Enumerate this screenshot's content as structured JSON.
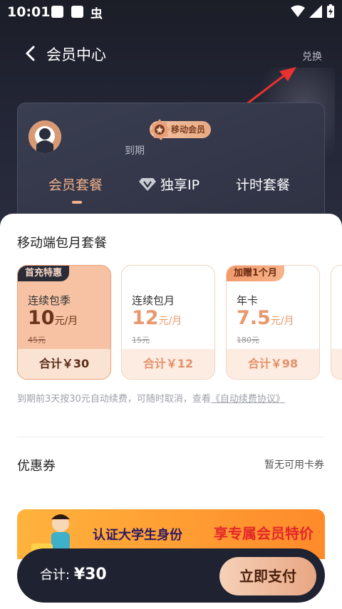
{
  "status_bar": {
    "time": "10:01",
    "bug_glyph": "虫"
  },
  "header": {
    "title": "会员中心",
    "redeem": "兑换"
  },
  "member_card": {
    "badge": "移动会员",
    "expire_label": "到期",
    "tabs": [
      {
        "label": "会员套餐",
        "active": true
      },
      {
        "label": "独享IP",
        "active": false
      },
      {
        "label": "计时套餐",
        "active": false
      }
    ]
  },
  "plans_section": {
    "title": "移动端包月套餐",
    "plans": [
      {
        "tag": "首充特惠",
        "name": "连续包季",
        "price": "10",
        "unit": "元/月",
        "original": "45元",
        "total": "合计￥30",
        "selected": true
      },
      {
        "tag": "",
        "name": "连续包月",
        "price": "12",
        "unit": "元/月",
        "original": "15元",
        "total": "合计￥12",
        "selected": false
      },
      {
        "tag": "加赠1个月",
        "name": "年卡",
        "price": "7.5",
        "unit": "元/月",
        "original": "180元",
        "total": "合计￥98",
        "selected": false
      }
    ],
    "renew_note": "到期前3天按30元自动续费，可随时取消，查看",
    "renew_link": "《自动续费协议》"
  },
  "coupon": {
    "label": "优惠券",
    "value": "暂无可用卡券"
  },
  "banner": {
    "text1": "认证大学生身份",
    "text2": "享专属会员特价"
  },
  "pay_bar": {
    "total_label": "合计:",
    "total_amount": "¥30",
    "pay_button": "立即支付"
  },
  "colors": {
    "accent": "#f2b08a",
    "dark_bg": "#1b1d27",
    "selected_plan": "#f7c2a3"
  }
}
